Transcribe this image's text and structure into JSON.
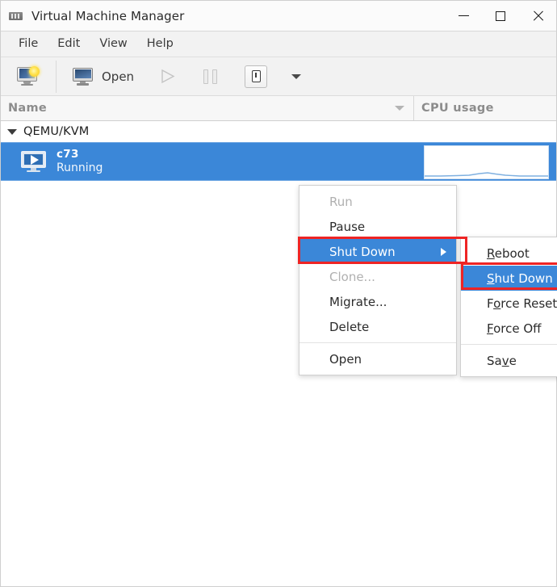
{
  "window": {
    "title": "Virtual Machine Manager",
    "icon": "vmm-app-icon",
    "controls": {
      "minimize": "minimize-icon",
      "maximize": "maximize-icon",
      "close": "close-icon"
    }
  },
  "menubar": {
    "items": [
      {
        "label": "File"
      },
      {
        "label": "Edit"
      },
      {
        "label": "View"
      },
      {
        "label": "Help"
      }
    ]
  },
  "toolbar": {
    "new_vm": {
      "icon": "new-vm-icon",
      "label": ""
    },
    "open": {
      "icon": "monitor-icon",
      "label": "Open"
    },
    "run": {
      "icon": "run-play-icon",
      "label": "",
      "enabled": false
    },
    "pause": {
      "icon": "pause-icon",
      "label": "",
      "enabled": false
    },
    "shutdown": {
      "icon": "shutdown-power-icon",
      "label": "",
      "enabled": true
    },
    "dropdown": {
      "icon": "chevron-down-icon",
      "label": ""
    }
  },
  "columns": {
    "name": "Name",
    "cpu": "CPU usage"
  },
  "list": {
    "connection": {
      "label": "QEMU/KVM",
      "expanded": true
    },
    "vms": [
      {
        "name": "c73",
        "state": "Running",
        "selected": true,
        "icon": "vm-running-icon"
      }
    ]
  },
  "context_menu": {
    "items": [
      {
        "label": "Run",
        "enabled": false,
        "selected": false,
        "submenu": false
      },
      {
        "label": "Pause",
        "enabled": true,
        "selected": false,
        "submenu": false
      },
      {
        "label": "Shut Down",
        "enabled": true,
        "selected": true,
        "submenu": true
      },
      {
        "label": "Clone...",
        "enabled": false,
        "selected": false,
        "submenu": false
      },
      {
        "label": "Migrate...",
        "enabled": true,
        "selected": false,
        "submenu": false
      },
      {
        "label": "Delete",
        "enabled": true,
        "selected": false,
        "submenu": false
      },
      {
        "separator": true
      },
      {
        "label": "Open",
        "enabled": true,
        "selected": false,
        "submenu": false
      }
    ]
  },
  "context_submenu": {
    "items": [
      {
        "label": "Reboot",
        "mnemonic": "R",
        "selected": false
      },
      {
        "label": "Shut Down",
        "mnemonic": "S",
        "selected": true
      },
      {
        "label": "Force Reset",
        "mnemonic": "o",
        "selected": false
      },
      {
        "label": "Force Off",
        "mnemonic": "F",
        "selected": false
      },
      {
        "separator": true
      },
      {
        "label": "Save",
        "mnemonic": "v",
        "selected": false
      }
    ]
  },
  "annotations": [
    {
      "target": "Shut Down",
      "color": "#ee2424",
      "location": "context-menu"
    },
    {
      "target": "Shut Down",
      "color": "#ee2424",
      "location": "context-submenu"
    }
  ],
  "colors": {
    "selection_blue": "#3b87d8",
    "annotation_red": "#ee2424",
    "toolbar_bg": "#f2f2f2",
    "titlebar_bg": "#fbfbfb"
  }
}
